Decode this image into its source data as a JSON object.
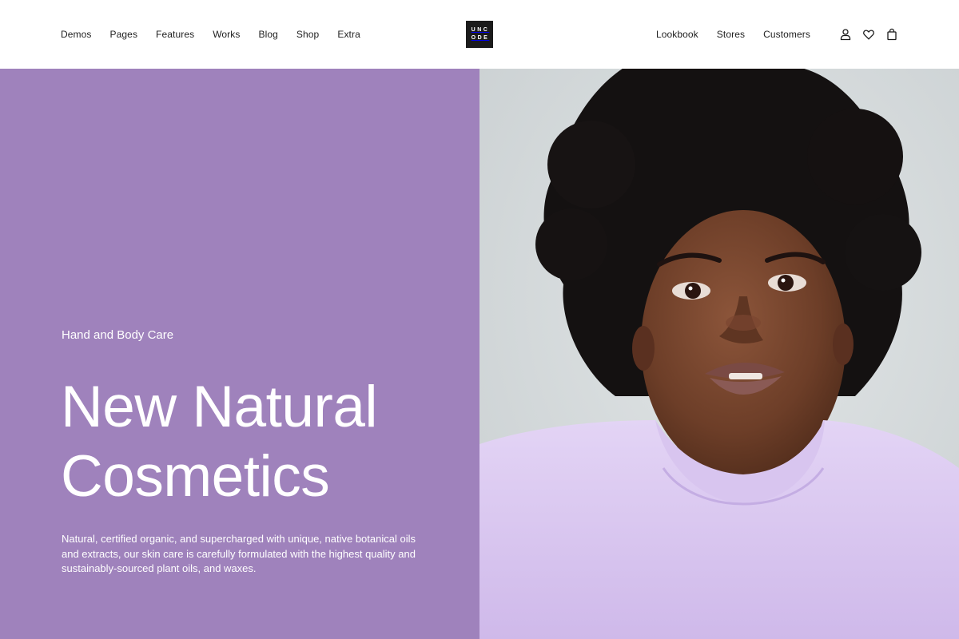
{
  "nav": {
    "left": [
      "Demos",
      "Pages",
      "Features",
      "Works",
      "Blog",
      "Shop",
      "Extra"
    ],
    "right": [
      "Lookbook",
      "Stores",
      "Customers"
    ]
  },
  "logo": {
    "line1": "UNC",
    "line2": "ODE"
  },
  "icons": [
    "user-icon",
    "heart-icon",
    "shopping-bag-icon"
  ],
  "hero": {
    "eyebrow": "Hand and Body Care",
    "headline_line1": "New Natural",
    "headline_line2": "Cosmetics",
    "body": "Natural, certified organic, and supercharged with unique, native botanical oils and extracts, our skin care is carefully formulated with the highest quality and sustainably-sourced plant oils, and waxes."
  },
  "colors": {
    "panel": "#9f82bc",
    "header_bg": "#ffffff",
    "logo_bg": "#1b1b1b",
    "photo_bg": "#d6dbdc",
    "sweater": "#dcc9f1"
  }
}
